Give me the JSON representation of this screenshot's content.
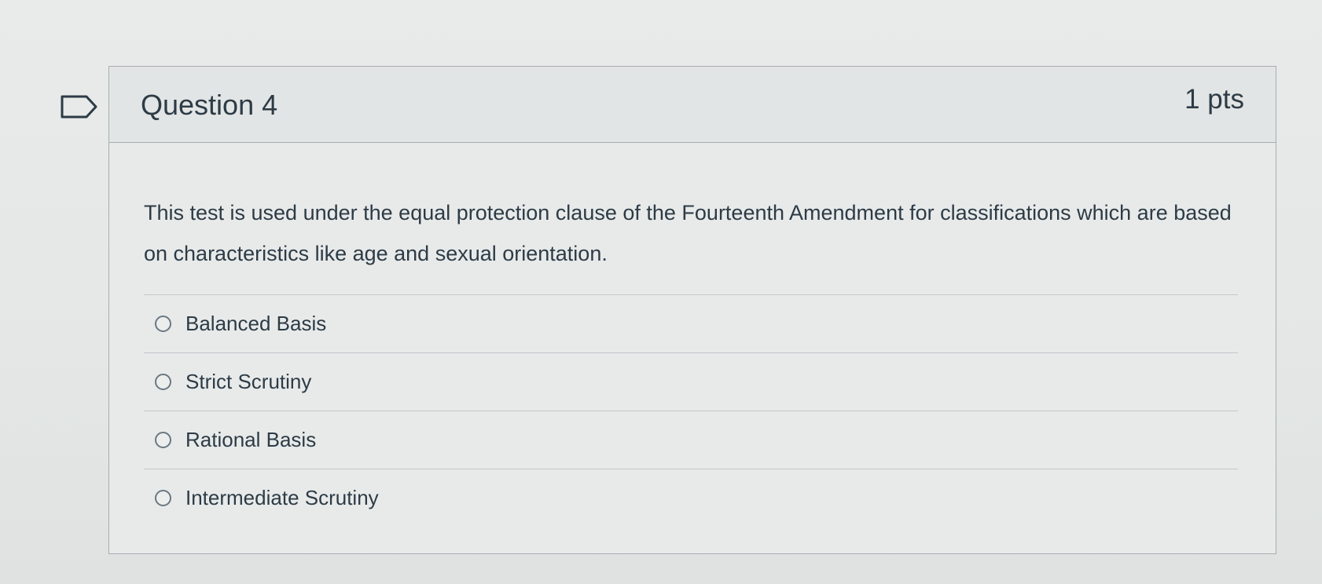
{
  "question": {
    "title": "Question 4",
    "points": "1 pts",
    "text": "This test is used under the equal protection clause of the Fourteenth Amendment for classifications which are based on characteristics like age and sexual orientation.",
    "flag_icon": "flag-outline-icon",
    "answers": [
      {
        "label": "Balanced Basis",
        "selected": false
      },
      {
        "label": "Strict Scrutiny",
        "selected": false
      },
      {
        "label": "Rational Basis",
        "selected": false
      },
      {
        "label": "Intermediate Scrutiny",
        "selected": false
      }
    ]
  },
  "colors": {
    "text": "#2d3b45",
    "border": "#a7adb0",
    "header_bg": "#e2e5e5"
  }
}
